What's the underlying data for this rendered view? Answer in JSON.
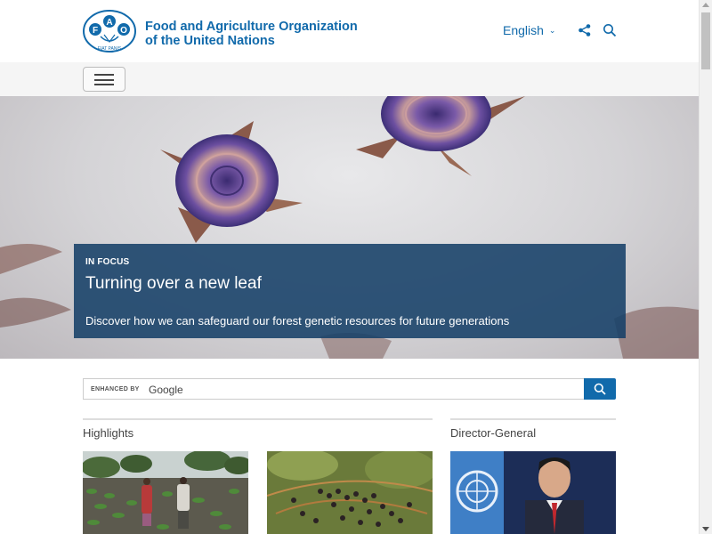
{
  "header": {
    "org_name_line1": "Food and Agriculture Organization",
    "org_name_line2": "of the United Nations",
    "logo_letters": [
      "F",
      "A",
      "O"
    ],
    "logo_motto": "FIAT PANIS",
    "language": "English"
  },
  "hero": {
    "label": "IN FOCUS",
    "title": "Turning over a new leaf",
    "description": "Discover how we can safeguard our forest genetic resources for future generations"
  },
  "search": {
    "enhanced_by": "ENHANCED BY",
    "provider": "Google"
  },
  "sections": {
    "highlights": "Highlights",
    "director_general": "Director-General"
  },
  "colors": {
    "brand_blue": "#116aab",
    "focus_box": "#164068"
  },
  "icons": [
    "fao-logo",
    "chevron-down-icon",
    "share-icon",
    "search-icon",
    "hamburger-menu-icon"
  ]
}
